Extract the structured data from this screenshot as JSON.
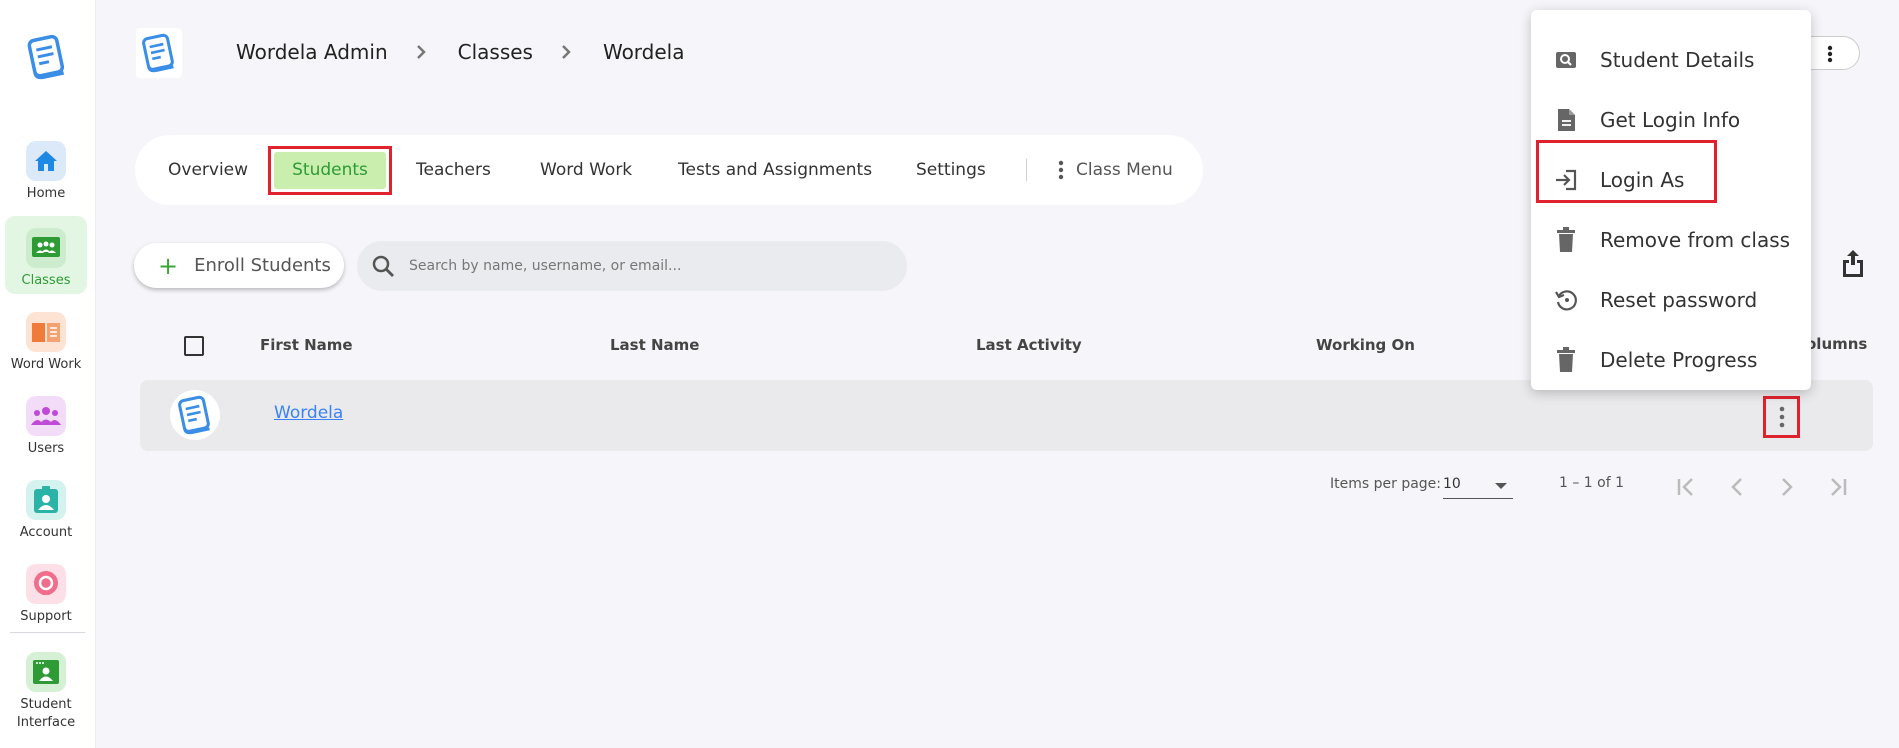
{
  "sidebar": {
    "items": [
      {
        "label": "Home",
        "color": "#1e88e5",
        "bg": "#dce9f8"
      },
      {
        "label": "Classes",
        "color": "#2e9b35",
        "bg": "#cdeccd"
      },
      {
        "label": "Word Work",
        "color": "#ef7a3a",
        "bg": "#fde3d3"
      },
      {
        "label": "Users",
        "color": "#c04ad8",
        "bg": "#f3dcf7"
      },
      {
        "label": "Account",
        "color": "#2bb3a8",
        "bg": "#d4f3ef"
      },
      {
        "label": "Support",
        "color": "#f06d8c",
        "bg": "#fde0e7"
      },
      {
        "label": "Student Interface",
        "color": "#2e9b35",
        "bg": "#d6f0d6"
      }
    ]
  },
  "header": {
    "breadcrumb": [
      "Wordela Admin",
      "Classes",
      "Wordela"
    ]
  },
  "tabs": {
    "overview": "Overview",
    "students": "Students",
    "teachers": "Teachers",
    "word_work": "Word Work",
    "tests": "Tests and Assignments",
    "settings": "Settings",
    "class_menu": "Class Menu"
  },
  "toolbar": {
    "enroll_label": "Enroll Students",
    "search_placeholder": "Search by name, username, or email..."
  },
  "table": {
    "columns": [
      "First Name",
      "Last Name",
      "Last Activity",
      "Working On",
      "Columns"
    ],
    "columns_visible_fragment": "olumns",
    "rows": [
      {
        "first_name": "Wordela",
        "last_name": "",
        "last_activity": "",
        "working_on": ""
      }
    ]
  },
  "pagination": {
    "items_per_page_label": "Items per page:",
    "items_per_page_value": "10",
    "range": "1 – 1 of 1"
  },
  "menu": {
    "items": [
      {
        "label": "Student Details",
        "icon": "student-details-icon"
      },
      {
        "label": "Get Login Info",
        "icon": "document-icon"
      },
      {
        "label": "Login As",
        "icon": "login-icon"
      },
      {
        "label": "Remove from class",
        "icon": "trash-icon"
      },
      {
        "label": "Reset password",
        "icon": "reset-icon"
      },
      {
        "label": "Delete Progress",
        "icon": "trash-icon"
      }
    ]
  },
  "colors": {
    "accent_green": "#2e9b35",
    "highlight_red": "#e0222f",
    "link_blue": "#3b82f6",
    "brand_blue": "#3a8ee6"
  }
}
